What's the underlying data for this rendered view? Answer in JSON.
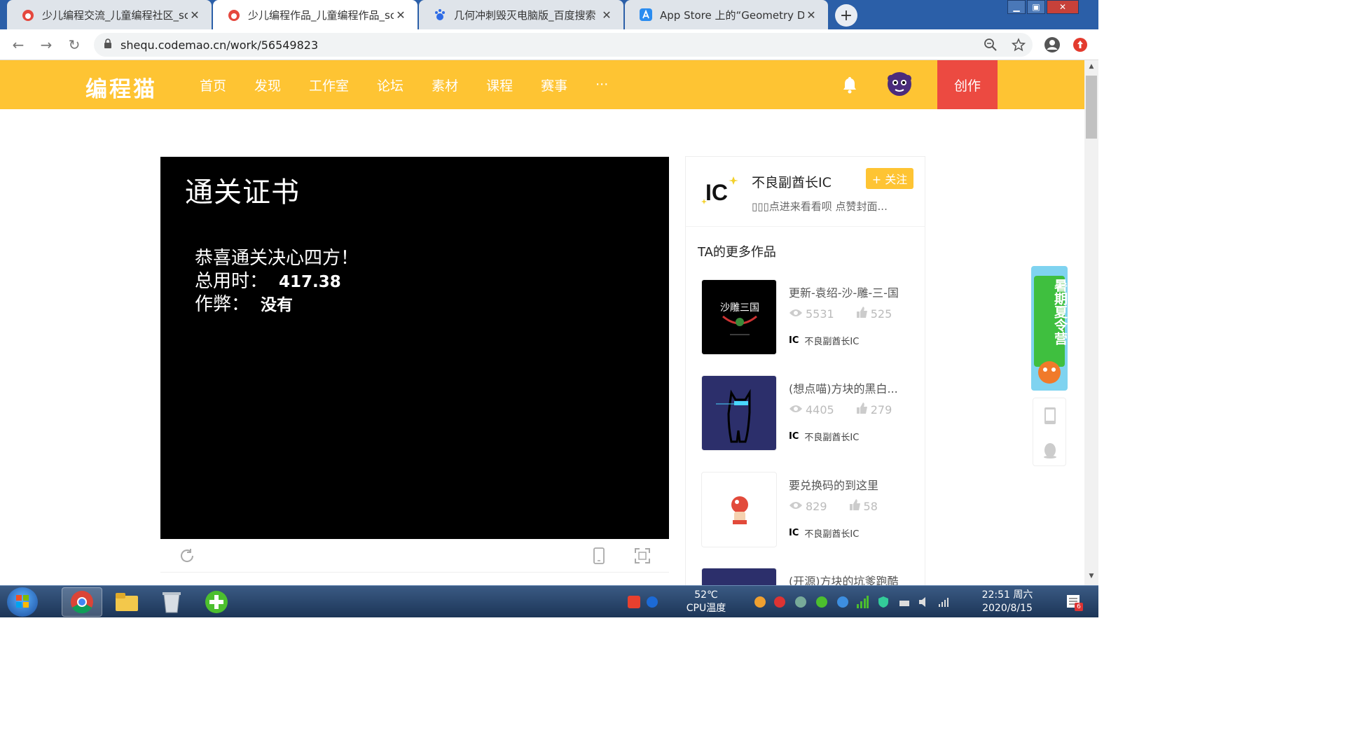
{
  "browser": {
    "tabs": [
      {
        "title": "少儿编程交流_儿童编程社区_scr",
        "active": false
      },
      {
        "title": "少儿编程作品_儿童编程作品_scr",
        "active": true
      },
      {
        "title": "几何冲刺毁灭电脑版_百度搜索",
        "active": false
      },
      {
        "title": "App Store 上的“Geometry Da",
        "active": false
      }
    ],
    "url": "shequ.codemao.cn/work/56549823"
  },
  "site": {
    "logo": "编程猫",
    "nav": [
      "首页",
      "发现",
      "工作室",
      "论坛",
      "素材",
      "课程",
      "赛事",
      "···"
    ],
    "create_label": "创作"
  },
  "player": {
    "title": "通关证书",
    "line1": "恭喜通关决心四方！",
    "time_label": "总用时：",
    "time_value": "417.38",
    "cheat_label": "作弊：",
    "cheat_value": "没有"
  },
  "author": {
    "name": "不良副酋长IC",
    "desc": "▯▯▯点进来看看呗 点赞封面...",
    "follow_label": "+ 关注",
    "avatar_text": "IC"
  },
  "more": {
    "title": "TA的更多作品",
    "works": [
      {
        "title": "更新-袁绍-沙-雕-三-国",
        "views": "5531",
        "likes": "525",
        "author": "不良副酋长IC",
        "thumb_text": "沙雕三国"
      },
      {
        "title": "(想点喵)方块的黑白...",
        "views": "4405",
        "likes": "279",
        "author": "不良副酋长IC",
        "thumb_text": ""
      },
      {
        "title": "要兑换码的到这里",
        "views": "829",
        "likes": "58",
        "author": "不良副酋长IC",
        "thumb_text": ""
      },
      {
        "title": "(开源)方块的坑爹跑酷",
        "views": "",
        "likes": "",
        "author": "",
        "thumb_text": ""
      }
    ]
  },
  "promo": {
    "text": "暑期夏令营"
  },
  "taskbar": {
    "temp": "52℃",
    "temp_label": "CPU温度",
    "time": "22:51 周六",
    "date": "2020/8/15",
    "badge": "6"
  }
}
